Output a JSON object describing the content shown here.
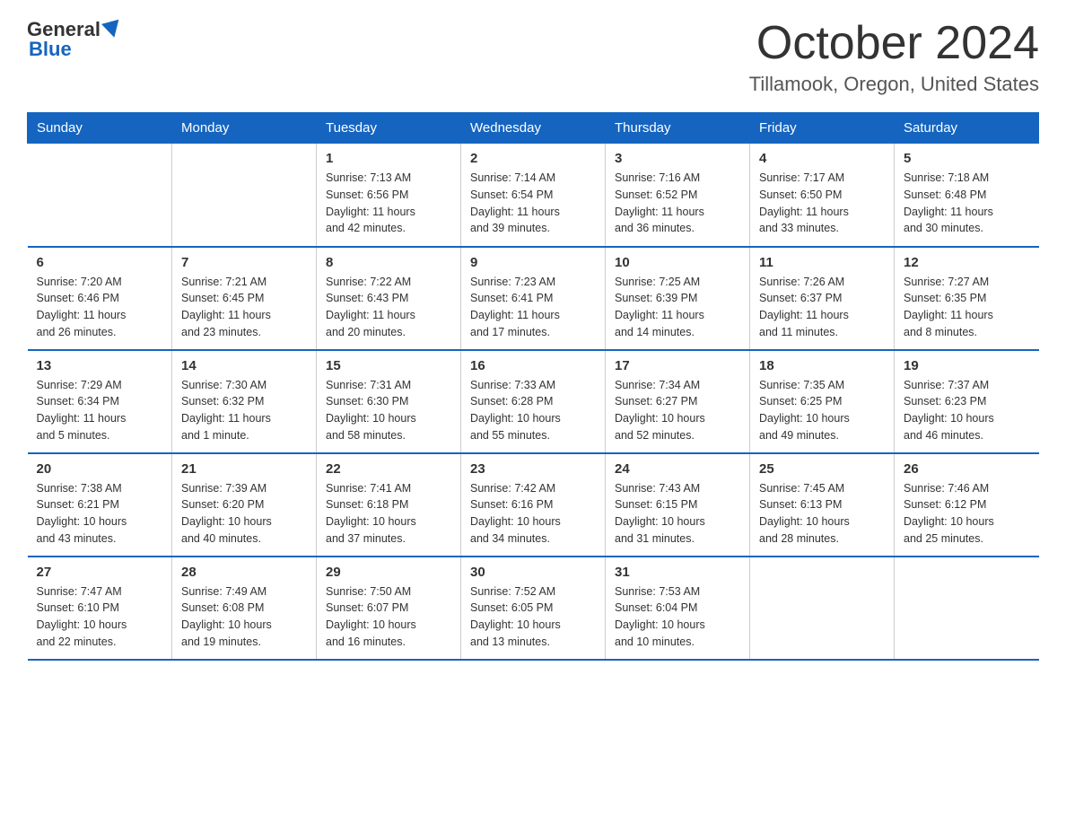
{
  "header": {
    "logo_general": "General",
    "logo_blue": "Blue",
    "month_title": "October 2024",
    "location": "Tillamook, Oregon, United States"
  },
  "days_of_week": [
    "Sunday",
    "Monday",
    "Tuesday",
    "Wednesday",
    "Thursday",
    "Friday",
    "Saturday"
  ],
  "weeks": [
    [
      {
        "day": "",
        "info": ""
      },
      {
        "day": "",
        "info": ""
      },
      {
        "day": "1",
        "info": "Sunrise: 7:13 AM\nSunset: 6:56 PM\nDaylight: 11 hours\nand 42 minutes."
      },
      {
        "day": "2",
        "info": "Sunrise: 7:14 AM\nSunset: 6:54 PM\nDaylight: 11 hours\nand 39 minutes."
      },
      {
        "day": "3",
        "info": "Sunrise: 7:16 AM\nSunset: 6:52 PM\nDaylight: 11 hours\nand 36 minutes."
      },
      {
        "day": "4",
        "info": "Sunrise: 7:17 AM\nSunset: 6:50 PM\nDaylight: 11 hours\nand 33 minutes."
      },
      {
        "day": "5",
        "info": "Sunrise: 7:18 AM\nSunset: 6:48 PM\nDaylight: 11 hours\nand 30 minutes."
      }
    ],
    [
      {
        "day": "6",
        "info": "Sunrise: 7:20 AM\nSunset: 6:46 PM\nDaylight: 11 hours\nand 26 minutes."
      },
      {
        "day": "7",
        "info": "Sunrise: 7:21 AM\nSunset: 6:45 PM\nDaylight: 11 hours\nand 23 minutes."
      },
      {
        "day": "8",
        "info": "Sunrise: 7:22 AM\nSunset: 6:43 PM\nDaylight: 11 hours\nand 20 minutes."
      },
      {
        "day": "9",
        "info": "Sunrise: 7:23 AM\nSunset: 6:41 PM\nDaylight: 11 hours\nand 17 minutes."
      },
      {
        "day": "10",
        "info": "Sunrise: 7:25 AM\nSunset: 6:39 PM\nDaylight: 11 hours\nand 14 minutes."
      },
      {
        "day": "11",
        "info": "Sunrise: 7:26 AM\nSunset: 6:37 PM\nDaylight: 11 hours\nand 11 minutes."
      },
      {
        "day": "12",
        "info": "Sunrise: 7:27 AM\nSunset: 6:35 PM\nDaylight: 11 hours\nand 8 minutes."
      }
    ],
    [
      {
        "day": "13",
        "info": "Sunrise: 7:29 AM\nSunset: 6:34 PM\nDaylight: 11 hours\nand 5 minutes."
      },
      {
        "day": "14",
        "info": "Sunrise: 7:30 AM\nSunset: 6:32 PM\nDaylight: 11 hours\nand 1 minute."
      },
      {
        "day": "15",
        "info": "Sunrise: 7:31 AM\nSunset: 6:30 PM\nDaylight: 10 hours\nand 58 minutes."
      },
      {
        "day": "16",
        "info": "Sunrise: 7:33 AM\nSunset: 6:28 PM\nDaylight: 10 hours\nand 55 minutes."
      },
      {
        "day": "17",
        "info": "Sunrise: 7:34 AM\nSunset: 6:27 PM\nDaylight: 10 hours\nand 52 minutes."
      },
      {
        "day": "18",
        "info": "Sunrise: 7:35 AM\nSunset: 6:25 PM\nDaylight: 10 hours\nand 49 minutes."
      },
      {
        "day": "19",
        "info": "Sunrise: 7:37 AM\nSunset: 6:23 PM\nDaylight: 10 hours\nand 46 minutes."
      }
    ],
    [
      {
        "day": "20",
        "info": "Sunrise: 7:38 AM\nSunset: 6:21 PM\nDaylight: 10 hours\nand 43 minutes."
      },
      {
        "day": "21",
        "info": "Sunrise: 7:39 AM\nSunset: 6:20 PM\nDaylight: 10 hours\nand 40 minutes."
      },
      {
        "day": "22",
        "info": "Sunrise: 7:41 AM\nSunset: 6:18 PM\nDaylight: 10 hours\nand 37 minutes."
      },
      {
        "day": "23",
        "info": "Sunrise: 7:42 AM\nSunset: 6:16 PM\nDaylight: 10 hours\nand 34 minutes."
      },
      {
        "day": "24",
        "info": "Sunrise: 7:43 AM\nSunset: 6:15 PM\nDaylight: 10 hours\nand 31 minutes."
      },
      {
        "day": "25",
        "info": "Sunrise: 7:45 AM\nSunset: 6:13 PM\nDaylight: 10 hours\nand 28 minutes."
      },
      {
        "day": "26",
        "info": "Sunrise: 7:46 AM\nSunset: 6:12 PM\nDaylight: 10 hours\nand 25 minutes."
      }
    ],
    [
      {
        "day": "27",
        "info": "Sunrise: 7:47 AM\nSunset: 6:10 PM\nDaylight: 10 hours\nand 22 minutes."
      },
      {
        "day": "28",
        "info": "Sunrise: 7:49 AM\nSunset: 6:08 PM\nDaylight: 10 hours\nand 19 minutes."
      },
      {
        "day": "29",
        "info": "Sunrise: 7:50 AM\nSunset: 6:07 PM\nDaylight: 10 hours\nand 16 minutes."
      },
      {
        "day": "30",
        "info": "Sunrise: 7:52 AM\nSunset: 6:05 PM\nDaylight: 10 hours\nand 13 minutes."
      },
      {
        "day": "31",
        "info": "Sunrise: 7:53 AM\nSunset: 6:04 PM\nDaylight: 10 hours\nand 10 minutes."
      },
      {
        "day": "",
        "info": ""
      },
      {
        "day": "",
        "info": ""
      }
    ]
  ]
}
